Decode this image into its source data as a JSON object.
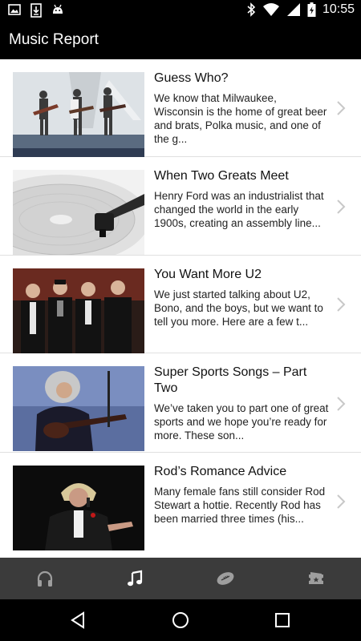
{
  "status_bar": {
    "time": "10:55",
    "left_icons": [
      "image-icon",
      "download-icon",
      "android-icon"
    ],
    "right_icons": [
      "bluetooth-icon",
      "wifi-icon",
      "signal-icon",
      "battery-icon"
    ]
  },
  "app_bar": {
    "title": "Music Report"
  },
  "articles": [
    {
      "title": "Guess Who?",
      "description": "We know that Milwaukee, Wisconsin is the home of great beer and brats, Polka music, and one of the g...",
      "thumbnail": "concert-band-photo"
    },
    {
      "title": "When Two Greats Meet",
      "description": "Henry Ford was an industrialist that changed the world in the early 1900s, creating an assembly line...",
      "thumbnail": "turntable-photo"
    },
    {
      "title": "You Want More U2",
      "description": "We just started talking about U2, Bono, and the boys, but we want to tell you more. Here are a few t...",
      "thumbnail": "band-red-carpet-photo"
    },
    {
      "title": "Super Sports Songs – Part Two",
      "description": "We’ve taken you to part one of great sports and we hope you’re ready for more. These son...",
      "thumbnail": "guitarist-photo"
    },
    {
      "title": "Rod’s Romance Advice",
      "description": "Many female fans still consider Rod Stewart a hottie. Recently Rod has been married three times (his...",
      "thumbnail": "singer-photo"
    }
  ],
  "bottom_nav": {
    "tabs": [
      {
        "icon": "headphones-icon",
        "active": false
      },
      {
        "icon": "music-note-icon",
        "active": true
      },
      {
        "icon": "football-icon",
        "active": false
      },
      {
        "icon": "ticket-icon",
        "active": false
      }
    ]
  },
  "system_nav": {
    "buttons": [
      "back-icon",
      "home-icon",
      "recents-icon"
    ]
  },
  "colors": {
    "status_bar": "#000000",
    "app_bar": "#000000",
    "list_background": "#ffffff",
    "bottom_nav": "#3b3b3b",
    "nav_icon_inactive": "#9e9e9e",
    "nav_icon_active": "#ffffff"
  }
}
